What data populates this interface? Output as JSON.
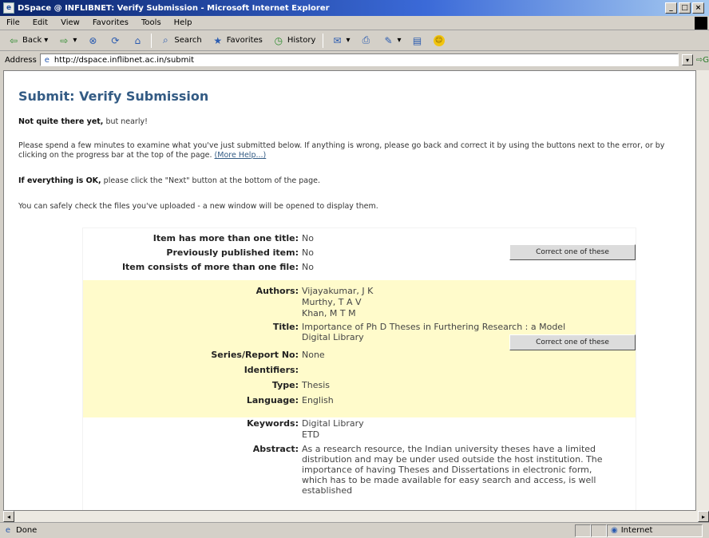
{
  "window": {
    "title": "DSpace @ INFLIBNET: Verify Submission - Microsoft Internet Explorer"
  },
  "menu": [
    "File",
    "Edit",
    "View",
    "Favorites",
    "Tools",
    "Help"
  ],
  "toolbar": {
    "back": "Back",
    "search": "Search",
    "favorites": "Favorites",
    "history": "History"
  },
  "address": {
    "label": "Address",
    "url": "http://dspace.inflibnet.ac.in/submit"
  },
  "page": {
    "title": "Submit: Verify Submission",
    "intro_bold": "Not quite there yet,",
    "intro_rest": " but nearly!",
    "instructions": "Please spend a few minutes to examine what you've just submitted below. If anything is wrong, please go back and correct it by using the buttons next to the error, or by clicking on the progress bar at the top of the page.",
    "more_help": "(More Help...)",
    "ok_bold": "If everything is OK,",
    "ok_rest": " please click the \"Next\" button at the bottom of the page.",
    "safe_check": "You can safely check the files you've uploaded - a new window will be opened to display them."
  },
  "section1": {
    "fields": [
      {
        "label": "Item has more than one title:",
        "value": "No"
      },
      {
        "label": "Previously published item:",
        "value": "No"
      },
      {
        "label": "Item consists of more than one file:",
        "value": "No"
      }
    ],
    "button": "Correct one of these"
  },
  "section2": {
    "authors_label": "Authors:",
    "authors": [
      "Vijayakumar, J K",
      "Murthy, T A V",
      "Khan, M T M"
    ],
    "title_label": "Title:",
    "title_value": "Importance of Ph D Theses in Furthering Research : a Model Digital Library",
    "series_label": "Series/Report No:",
    "series_value": "None",
    "identifiers_label": "Identifiers:",
    "type_label": "Type:",
    "type_value": "Thesis",
    "language_label": "Language:",
    "language_value": "English",
    "button": "Correct one of these"
  },
  "section3": {
    "keywords_label": "Keywords:",
    "keywords": [
      "Digital Library",
      "ETD"
    ],
    "abstract_label": "Abstract:",
    "abstract_value": "As a research resource, the Indian university theses have a limited distribution and may be under used outside the host institution. The importance of having Theses and Dissertations in electronic form, which has to be made available for easy search and access, is well established"
  },
  "status": {
    "left": "Done",
    "zone": "Internet"
  }
}
